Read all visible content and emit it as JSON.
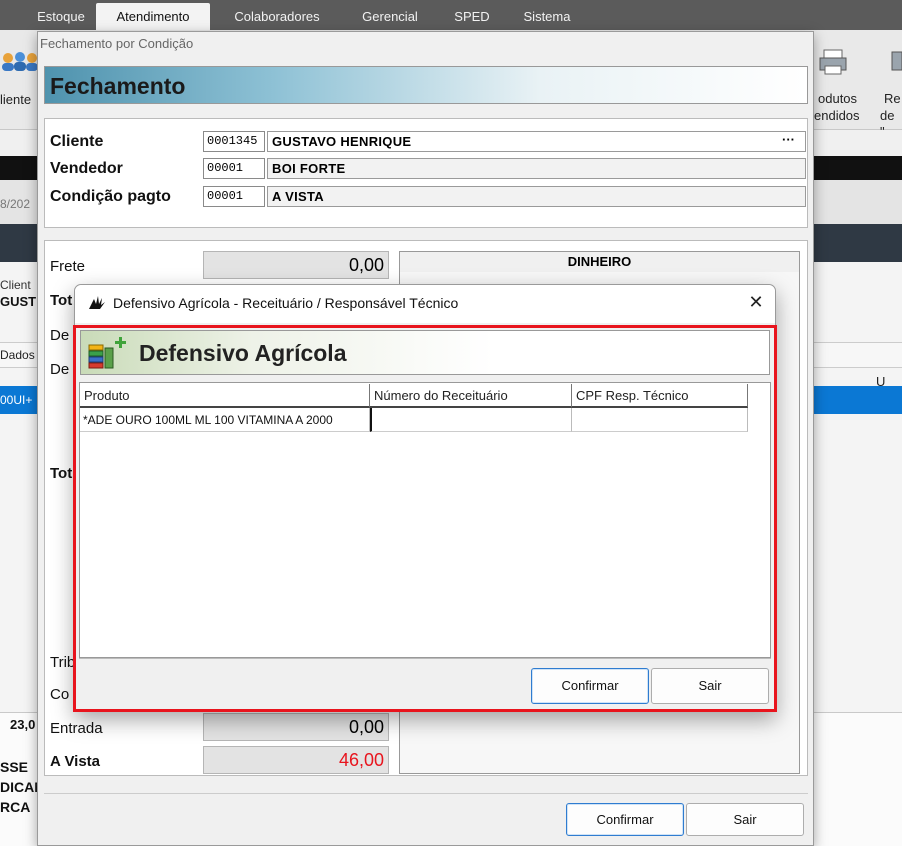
{
  "menubar": {
    "items": [
      "Estoque",
      "Atendimento",
      "Colaboradores",
      "Gerencial",
      "SPED",
      "Sistema"
    ],
    "active": "Atendimento"
  },
  "toolbar": {
    "left_label": "liente",
    "right1_line1": "odutos",
    "right1_line2": "endidos",
    "right2_line1": "Re",
    "right2_line2": "de \""
  },
  "background": {
    "date_fragment": "8/202",
    "cliente_fragment": "Client",
    "gust_fragment": "GUST",
    "dados_fragment": "Dados",
    "u_fragment": "U",
    "row_fragment": "00UI+",
    "value_fragment": "23,0",
    "line1": "SSE",
    "line2": "DICAM",
    "line3": "RCA"
  },
  "fechamento": {
    "window_title": "Fechamento por Condição",
    "header": "Fechamento",
    "cliente_label": "Cliente",
    "cliente_code": "0001345",
    "cliente_name": "GUSTAVO HENRIQUE",
    "cliente_ellipsis": "···",
    "vendedor_label": "Vendedor",
    "vendedor_code": "00001",
    "vendedor_name": "BOI FORTE",
    "condicao_label": "Condição pagto",
    "condicao_code": "00001",
    "condicao_name": "A VISTA",
    "frete_label": "Frete",
    "frete_value": "0,00",
    "dinheiro_label": "DINHEIRO",
    "tot_fragment_1": "Tot",
    "de_fragment_1": "De",
    "de_fragment_2": "De",
    "tot_fragment_2": "Tot",
    "tri_fragment": "Trib",
    "co_fragment": "Co",
    "entrada_label": "Entrada",
    "entrada_value": "0,00",
    "avista_label": "A Vista",
    "avista_value": "46,00",
    "confirmar_label": "Confirmar",
    "sair_label": "Sair"
  },
  "dialog": {
    "title": "Defensivo Agrícola - Receituário / Responsável Técnico",
    "close_glyph": "✕",
    "header": "Defensivo Agrícola",
    "columns": [
      "Produto",
      "Número do Receituário",
      "CPF Resp. Técnico"
    ],
    "rows": [
      {
        "produto": "*ADE OURO 100ML ML 100 VITAMINA A 2000",
        "receituario": "",
        "cpf": ""
      }
    ],
    "confirmar_label": "Confirmar",
    "sair_label": "Sair"
  },
  "colors": {
    "accent_blue": "#0b78d4",
    "highlight_red": "#e8141d",
    "avista_red": "#e8141d"
  }
}
